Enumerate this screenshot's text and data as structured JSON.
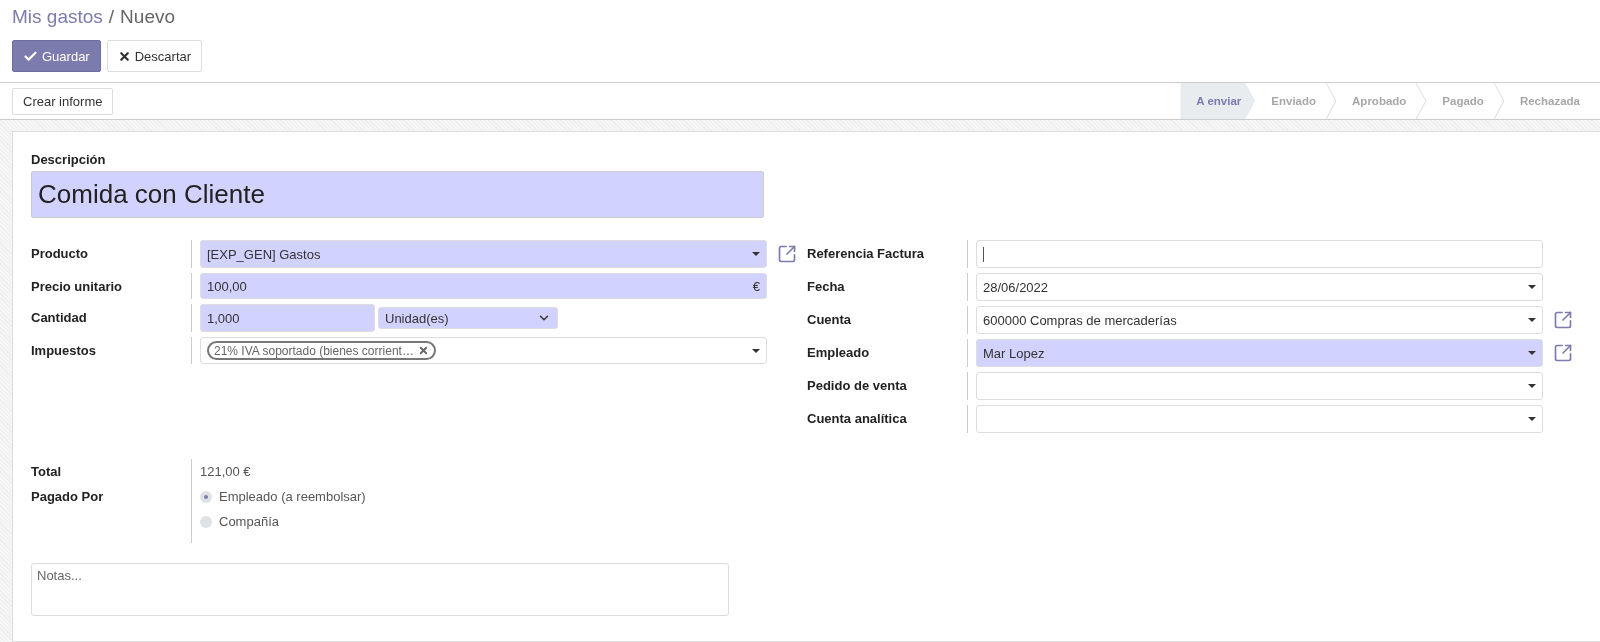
{
  "breadcrumb": {
    "parent": "Mis gastos",
    "separator": "/",
    "current": "Nuevo"
  },
  "actions": [
    {
      "label": "Guardar",
      "kind": "primary"
    },
    {
      "label": "Descartar",
      "kind": "secondary"
    }
  ],
  "status_bar": {
    "button": "Crear informe",
    "stages": [
      {
        "label": "A enviar",
        "selected": true
      },
      {
        "label": "Enviado",
        "selected": false
      },
      {
        "label": "Aprobado",
        "selected": false
      },
      {
        "label": "Pagado",
        "selected": false
      },
      {
        "label": "Rechazada",
        "selected": false
      }
    ]
  },
  "description": {
    "label": "Descripción",
    "value": "Comida con Cliente",
    "required": true
  },
  "left_fields": [
    {
      "label": "Producto",
      "kind": "select",
      "value": "[EXP_GEN] Gastos",
      "required": true,
      "external_link": true
    },
    {
      "label": "Precio unitario",
      "kind": "monetary",
      "value": "100,00",
      "currency": "€",
      "required": true,
      "external_link": false
    },
    {
      "label": "Cantidad",
      "kind": "quantity",
      "value": "1,000",
      "unit": "Unidad(es)",
      "required": true,
      "external_link": false
    },
    {
      "label": "Impuestos",
      "kind": "tags",
      "tags": [
        "21% IVA soportado (bienes corrient…"
      ],
      "required": false,
      "external_link": false
    }
  ],
  "right_fields": [
    {
      "label": "Referencia Factura",
      "kind": "text",
      "focused": true,
      "required": false,
      "external_link": false
    },
    {
      "label": "Fecha",
      "kind": "select",
      "value": "28/06/2022",
      "required": false,
      "external_link": false
    },
    {
      "label": "Cuenta",
      "kind": "select",
      "value": "600000 Compras de mercaderías",
      "required": false,
      "external_link": true
    },
    {
      "label": "Empleado",
      "kind": "select",
      "value": "Mar Lopez",
      "required": true,
      "external_link": true
    },
    {
      "label": "Pedido de venta",
      "kind": "select",
      "required": false,
      "external_link": false
    },
    {
      "label": "Cuenta analítica",
      "kind": "select",
      "required": false,
      "external_link": false
    }
  ],
  "total": {
    "label": "Total",
    "value": "121,00 €"
  },
  "paid_by": {
    "label": "Pagado Por",
    "options": [
      {
        "label": "Empleado (a reembolsar)",
        "selected": true
      },
      {
        "label": "Compañía",
        "selected": false
      }
    ]
  },
  "notes": {
    "placeholder": "Notas..."
  }
}
